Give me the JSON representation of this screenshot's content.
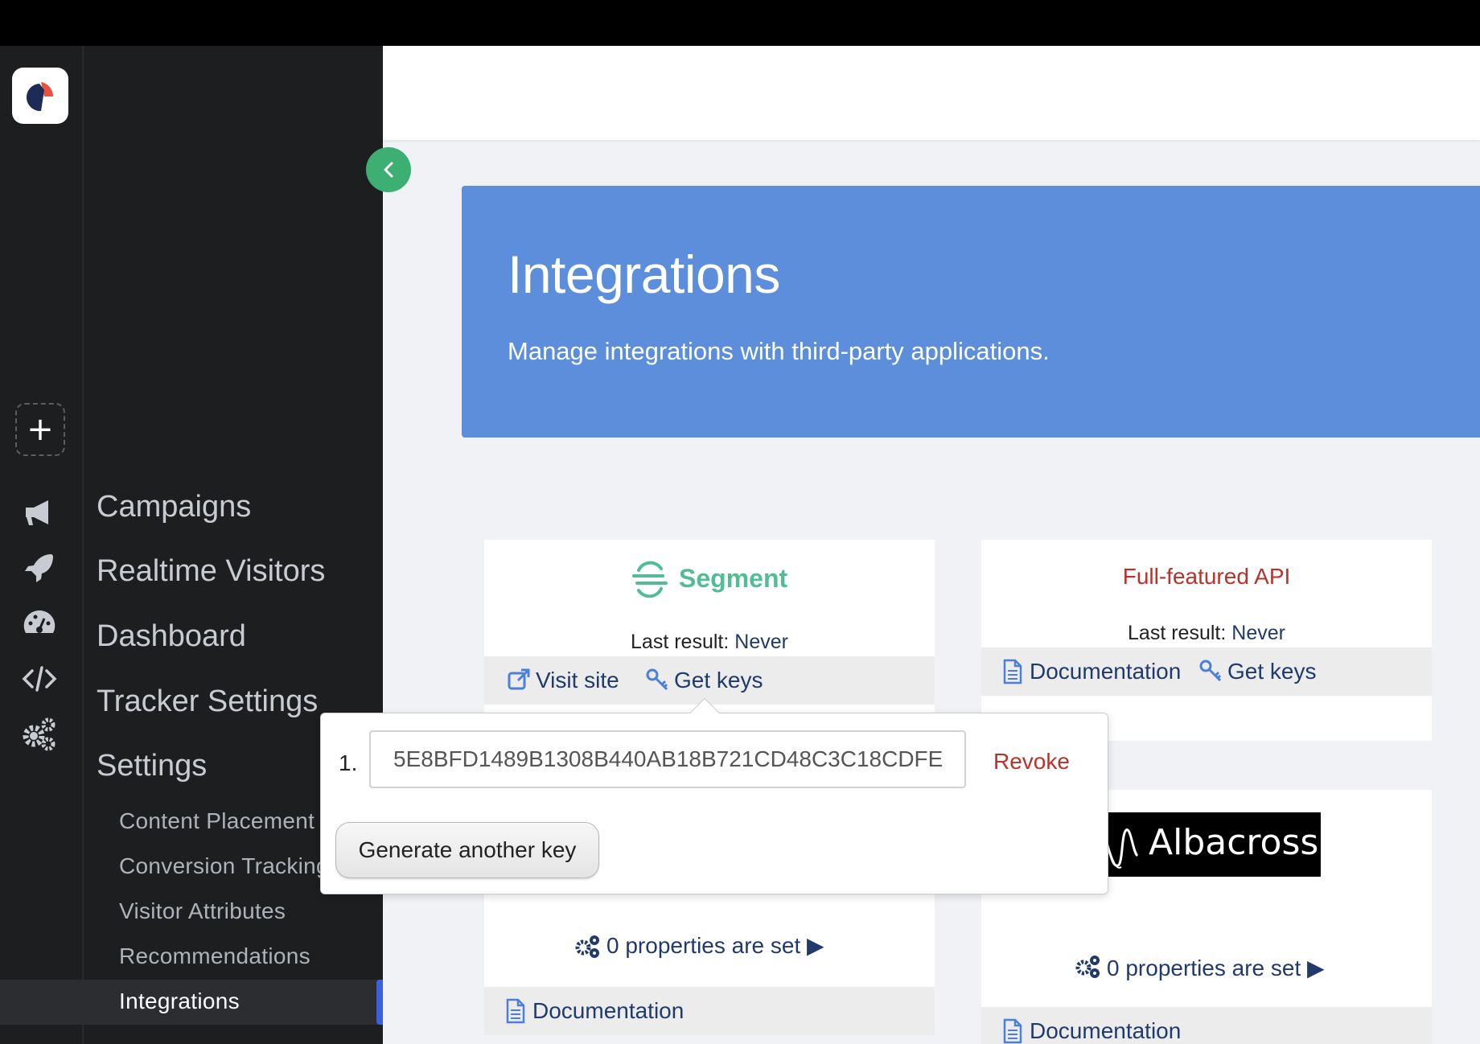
{
  "sidebar": {
    "add_label": "+",
    "nav": [
      {
        "label": "Campaigns",
        "icon": "megaphone-icon"
      },
      {
        "label": "Realtime Visitors",
        "icon": "rocket-icon"
      },
      {
        "label": "Dashboard",
        "icon": "gauge-icon"
      },
      {
        "label": "Tracker Settings",
        "icon": "code-icon"
      },
      {
        "label": "Settings",
        "icon": "gears-icon"
      }
    ],
    "sub": [
      {
        "label": "Content Placement"
      },
      {
        "label": "Conversion Tracking"
      },
      {
        "label": "Visitor Attributes"
      },
      {
        "label": "Recommendations"
      },
      {
        "label": "Integrations",
        "active": true
      }
    ]
  },
  "header": {
    "title": "Integrations",
    "subtitle": "Manage integrations with third-party applications."
  },
  "cards": {
    "segment": {
      "name": "Segment",
      "last_result_label": "Last result:",
      "last_result_value": "Never",
      "visit_site": "Visit site",
      "get_keys": "Get keys"
    },
    "api": {
      "name": "Full-featured API",
      "last_result_label": "Last result:",
      "last_result_value": "Never",
      "documentation": "Documentation",
      "get_keys": "Get keys"
    },
    "card3": {
      "properties": "0 properties are set ▶",
      "documentation": "Documentation"
    },
    "albacross": {
      "name": "Albacross",
      "properties": "0 properties are set ▶",
      "documentation": "Documentation"
    }
  },
  "popover": {
    "index": "1.",
    "key": "5E8BFD1489B1308B440AB18B721CD48C3C18CDFE",
    "revoke": "Revoke",
    "generate": "Generate another key"
  },
  "colors": {
    "accent": "#5c8edb",
    "segment_green": "#52bd94",
    "api_red": "#b8332a",
    "link_blue": "#1f3a6b",
    "collapse_green": "#3daf73"
  }
}
